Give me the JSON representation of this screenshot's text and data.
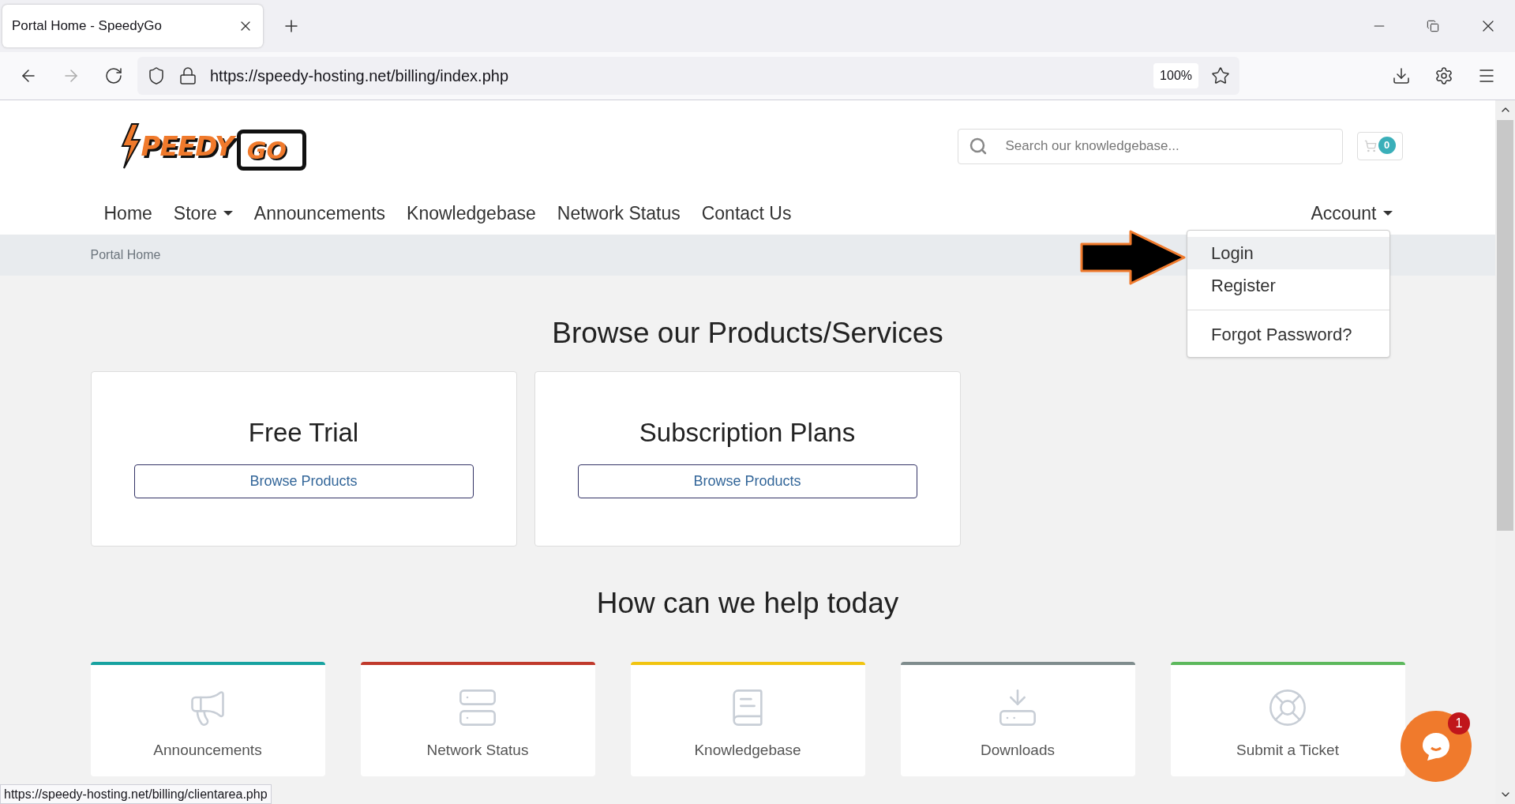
{
  "browser": {
    "tab_title": "Portal Home - SpeedyGo",
    "url": "https://speedy-hosting.net/billing/index.php",
    "zoom": "100%",
    "status_url": "https://speedy-hosting.net/billing/clientarea.php"
  },
  "header": {
    "logo": {
      "word": "PEEDY",
      "screen_word": "GO"
    },
    "search": {
      "placeholder": "Search our knowledgebase..."
    },
    "cart_count": "0"
  },
  "nav": {
    "items": [
      {
        "label": "Home",
        "dropdown": false
      },
      {
        "label": "Store",
        "dropdown": true
      },
      {
        "label": "Announcements",
        "dropdown": false
      },
      {
        "label": "Knowledgebase",
        "dropdown": false
      },
      {
        "label": "Network Status",
        "dropdown": false
      },
      {
        "label": "Contact Us",
        "dropdown": false
      }
    ],
    "account": {
      "label": "Account",
      "menu": [
        {
          "label": "Login",
          "selected": true
        },
        {
          "label": "Register",
          "selected": false
        },
        {
          "label": "Forgot Password?",
          "selected": false
        }
      ]
    }
  },
  "breadcrumb": "Portal Home",
  "products": {
    "heading": "Browse our Products/Services",
    "cards": [
      {
        "title": "Free Trial",
        "button": "Browse Products"
      },
      {
        "title": "Subscription Plans",
        "button": "Browse Products"
      }
    ]
  },
  "help": {
    "heading": "How can we help today",
    "cards": [
      {
        "label": "Announcements",
        "color": "#17a2a0"
      },
      {
        "label": "Network Status",
        "color": "#c0392b"
      },
      {
        "label": "Knowledgebase",
        "color": "#f1c40f"
      },
      {
        "label": "Downloads",
        "color": "#7f8c8d"
      },
      {
        "label": "Submit a Ticket",
        "color": "#5cb85c"
      }
    ]
  },
  "chat": {
    "badge": "1"
  }
}
